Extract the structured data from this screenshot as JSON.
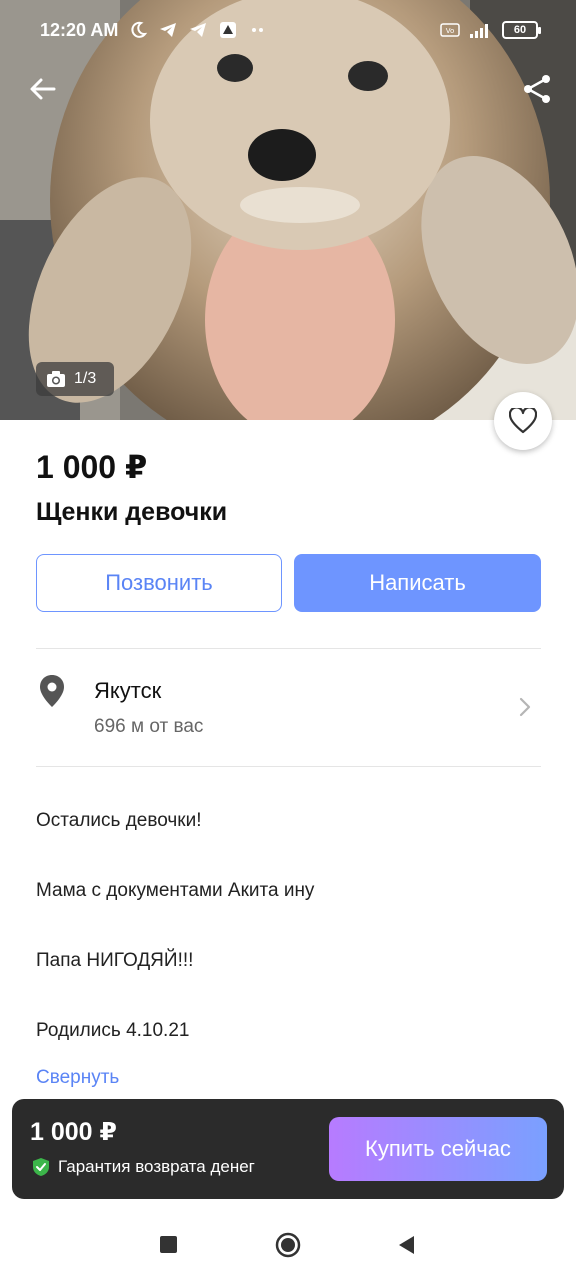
{
  "status_bar": {
    "time": "12:20 AM",
    "battery": "60",
    "network": "4G"
  },
  "photo": {
    "counter": "1/3",
    "icons": [
      "back-arrow-icon",
      "share-icon",
      "camera-icon",
      "heart-icon"
    ]
  },
  "listing": {
    "price": "1 000 ₽",
    "title": "Щенки девочки"
  },
  "actions": {
    "call_label": "Позвонить",
    "write_label": "Написать"
  },
  "location": {
    "city": "Якутск",
    "distance": "696 м от вас"
  },
  "description": {
    "lines": [
      "Остались девочки!",
      "Мама с документами Акита ину",
      "Папа НИГОДЯЙ!!!",
      "Родились 4.10.21"
    ],
    "collapse_label": "Свернуть"
  },
  "buy_bar": {
    "price": "1 000 ₽",
    "guarantee": "Гарантия возврата денег",
    "buy_label": "Купить сейчас"
  },
  "colors": {
    "accent": "#6e95ff",
    "buy_gradient_start": "#b77bff",
    "buy_gradient_end": "#7aa0ff",
    "guarantee_green": "#3cb54a",
    "buy_bar_bg": "#2b2b2b"
  }
}
